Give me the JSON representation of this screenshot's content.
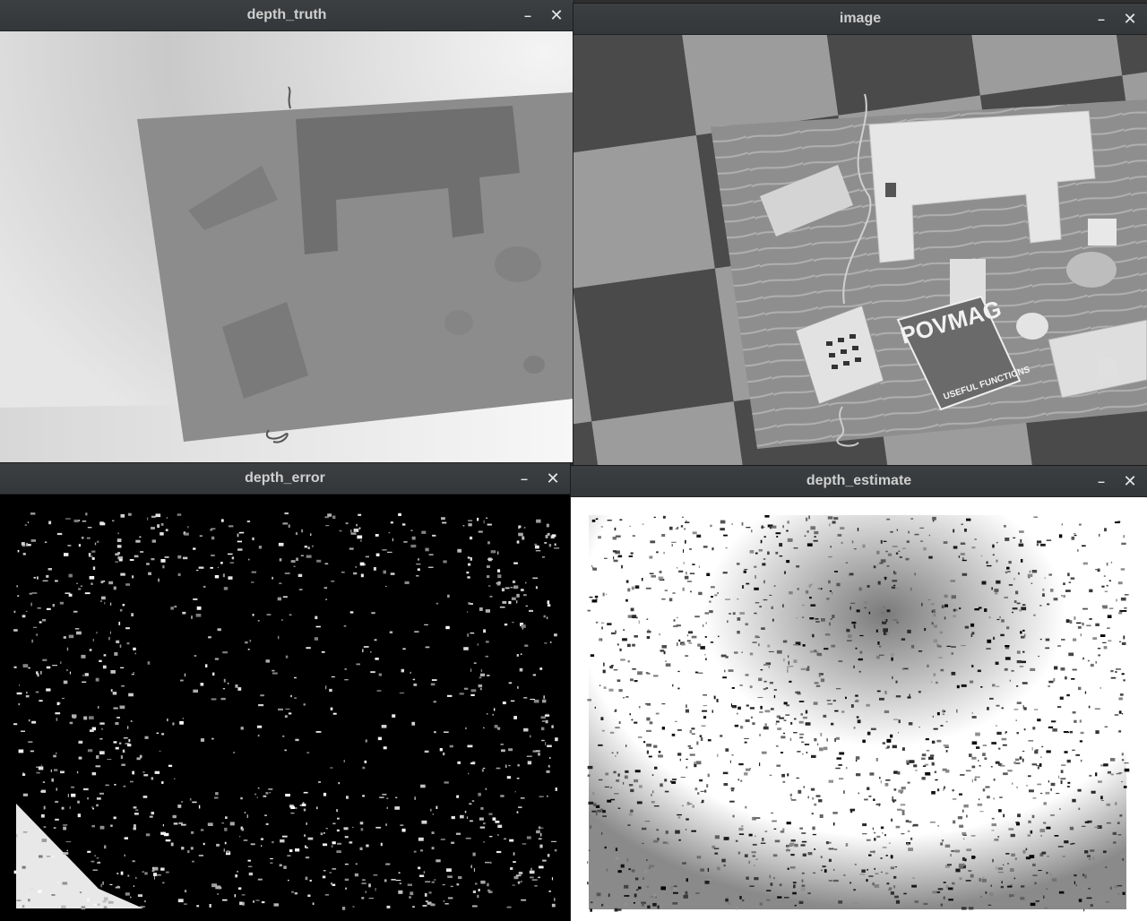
{
  "windows": {
    "depth_truth": {
      "title": "depth_truth",
      "minimize": "–",
      "close": "✕"
    },
    "image": {
      "title": "image",
      "minimize": "–",
      "close": "✕"
    },
    "depth_error": {
      "title": "depth_error",
      "minimize": "–",
      "close": "✕"
    },
    "depth_estimate": {
      "title": "depth_estimate",
      "minimize": "–",
      "close": "✕"
    }
  },
  "image_scene": {
    "magazine_title": "POVMAG",
    "magazine_footer": "USEFUL FUNCTIONS"
  }
}
